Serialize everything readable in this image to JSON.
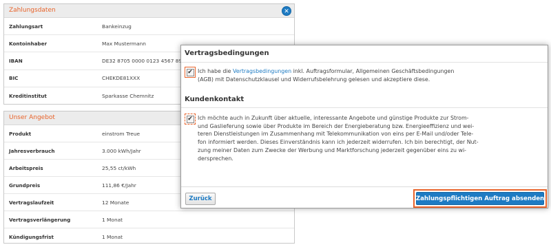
{
  "zahlungsdaten": {
    "title": "Zahlungsdaten",
    "close_glyph": "✕",
    "rows": [
      {
        "label": "Zahlungsart",
        "value": "Bankeinzug"
      },
      {
        "label": "Kontoinhaber",
        "value": "Max Mustermann"
      },
      {
        "label": "IBAN",
        "value": "DE32 8705 0000 0123 4567 89"
      },
      {
        "label": "BIC",
        "value": "CHEKDE81XXX"
      },
      {
        "label": "Kreditinstitut",
        "value": "Sparkasse Chemnitz"
      }
    ]
  },
  "angebot": {
    "title": "Unser Angebot",
    "rows": [
      {
        "label": "Produkt",
        "value": "einstrom Treue"
      },
      {
        "label": "Jahresverbrauch",
        "value": "3.000 kWh/Jahr"
      },
      {
        "label": "Arbeitspreis",
        "value": "25,55 ct/kWh"
      },
      {
        "label": "Grundpreis",
        "value": "111,86 €/Jahr"
      },
      {
        "label": "Vertragslaufzeit",
        "value": "12 Monate"
      },
      {
        "label": "Vertragsverlängerung",
        "value": "1 Monat"
      },
      {
        "label": "Kündigungsfrist",
        "value": "1 Monat"
      }
    ]
  },
  "modal": {
    "vertrag": {
      "title": "Vertragsbedingungen",
      "checked": true,
      "text_before": "Ich habe die ",
      "link": "Vertragsbedingungen",
      "text_line1_after": " inkl. Auftragsformular, Allgemeinen Geschäftsbedingungen",
      "text_line2": "(AGB) mit Datenschutzklausel und Widerrufsbelehrung gelesen und akzeptiere diese."
    },
    "kunden": {
      "title": "Kundenkontakt",
      "checked": true,
      "lines": [
        "Ich möchte auch in Zukunft über aktuelle, interessante Angebote und günstige Produkte zur Strom-",
        "und Gaslieferung sowie über Produkte im Bereich der Energieberatung bzw. Energieeffizienz und wei-",
        "teren Dienstleistungen im Zusammenhang mit Telekommunikation von eins per E-Mail und/oder Tele-",
        "fon informiert werden. Dieses Einverständnis kann ich jederzeit widerrufen. Ich bin berechtigt, der Nut-",
        "zung meiner Daten zum Zwecke der Werbung und Marktforschung jederzeit gegenüber eins zu wi-",
        "dersprechen."
      ]
    },
    "check_glyph": "✔",
    "back_label": "Zurück",
    "submit_label": "Zahlungspflichtigen Auftrag absenden"
  },
  "colors": {
    "accent_orange": "#e8632a",
    "link_blue": "#1e7bc3"
  }
}
